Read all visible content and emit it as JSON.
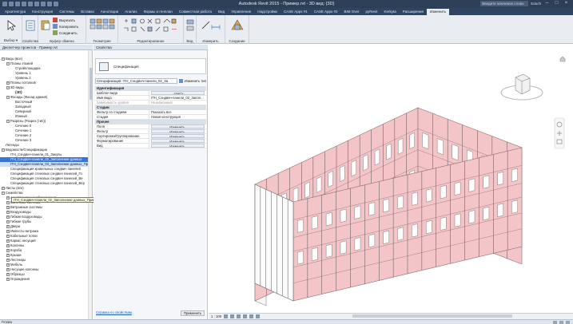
{
  "window": {
    "title": "Autodesk Revit 2015 -    Пример.rvt - 3D вид: {3D}",
    "search_placeholder": "Введите ключевое слово или фразу",
    "user": "Educh"
  },
  "ribbon": {
    "tabs": [
      "Архитектура",
      "Конструкция",
      "Системы",
      "Вставка",
      "Аннотации",
      "Анализ",
      "Формы и генплан",
      "Совместная работа",
      "Вид",
      "Управление",
      "Надстройки",
      "CASE Apps #1",
      "CASE Apps #2",
      "BIM Over",
      "pyRevit",
      "Kerkyta",
      "Расширения",
      "Изменить"
    ],
    "active_tab": "Изменить",
    "groups": {
      "select": "Выбор ▾",
      "properties": "Свойства",
      "clipboard": "Буфер обмена",
      "geometry": "Геометрия",
      "modify": "Редактирование",
      "view": "Вид",
      "measure": "Измерить",
      "create": "Создание"
    },
    "small_buttons": {
      "cut": "Вырезать",
      "copy": "Копировать",
      "join": "Соединить",
      "paste": "Вставить"
    }
  },
  "browser": {
    "title": "Диспетчер проектов - Пример.rvt",
    "tooltip": "ITH_Сэндвич-панели_02_Заполнение данных_Принудительная",
    "items": [
      {
        "indent": 0,
        "toggle": "−",
        "label": "Виды (все)"
      },
      {
        "indent": 1,
        "toggle": "−",
        "label": "Планы этажей"
      },
      {
        "indent": 2,
        "toggle": "",
        "label": "Стройплощадка"
      },
      {
        "indent": 2,
        "toggle": "",
        "label": "Уровень 1"
      },
      {
        "indent": 2,
        "toggle": "",
        "label": "Уровень 2"
      },
      {
        "indent": 1,
        "toggle": "+",
        "label": "Планы потолков"
      },
      {
        "indent": 1,
        "toggle": "−",
        "label": "3D виды"
      },
      {
        "indent": 2,
        "toggle": "",
        "label": "{3D}",
        "bold": true
      },
      {
        "indent": 1,
        "toggle": "−",
        "label": "Фасады (Фасад здания)"
      },
      {
        "indent": 2,
        "toggle": "",
        "label": "Восточный"
      },
      {
        "indent": 2,
        "toggle": "",
        "label": "Западный"
      },
      {
        "indent": 2,
        "toggle": "",
        "label": "Северный"
      },
      {
        "indent": 2,
        "toggle": "",
        "label": "Южный"
      },
      {
        "indent": 1,
        "toggle": "−",
        "label": "Разрезы (Разрез (тип))"
      },
      {
        "indent": 2,
        "toggle": "",
        "label": "Сечение 0"
      },
      {
        "indent": 2,
        "toggle": "",
        "label": "Сечение 1"
      },
      {
        "indent": 2,
        "toggle": "",
        "label": "Сечение 2"
      },
      {
        "indent": 2,
        "toggle": "",
        "label": "Сечение 3"
      },
      {
        "indent": 0,
        "toggle": "",
        "label": "Легенды"
      },
      {
        "indent": 0,
        "toggle": "−",
        "label": "Ведомости/Спецификации"
      },
      {
        "indent": 1,
        "toggle": "",
        "label": "ITH_Сэндвич-панели_01_Закупы"
      },
      {
        "indent": 1,
        "toggle": "",
        "label": "ITH_Сэндвич-панели_02_Заполнение данных",
        "state": "sel"
      },
      {
        "indent": 1,
        "toggle": "",
        "label": "ITH_Сэндвич-панели_03_Заполнение данных_Принудительная",
        "state": "hl"
      },
      {
        "indent": 1,
        "toggle": "",
        "label": "Спецификация кровельных сэндвич панелей"
      },
      {
        "indent": 1,
        "toggle": "",
        "label": "Спецификация стеновых сэндвич панелей_Го"
      },
      {
        "indent": 1,
        "toggle": "",
        "label": "Спецификация стеновых сэндвич панелей_Ве"
      },
      {
        "indent": 1,
        "toggle": "",
        "label": "Спецификация стеновых сэндвич панелей_Вер"
      },
      {
        "indent": 0,
        "toggle": "+",
        "label": "Листы (все)"
      },
      {
        "indent": 0,
        "toggle": "−",
        "label": "Семейства"
      },
      {
        "indent": 1,
        "toggle": "+",
        "label": "Аннотационные обозначения"
      },
      {
        "indent": 1,
        "toggle": "+",
        "label": "Балочные системы"
      },
      {
        "indent": 1,
        "toggle": "+",
        "label": "Витражные системы"
      },
      {
        "indent": 1,
        "toggle": "+",
        "label": "Воздуховоды"
      },
      {
        "indent": 1,
        "toggle": "+",
        "label": "Гибкие воздуховоды"
      },
      {
        "indent": 1,
        "toggle": "+",
        "label": "Гибкие трубы"
      },
      {
        "indent": 1,
        "toggle": "+",
        "label": "Двери"
      },
      {
        "indent": 1,
        "toggle": "+",
        "label": "Импосты витража"
      },
      {
        "indent": 1,
        "toggle": "+",
        "label": "Кабельные лотки"
      },
      {
        "indent": 1,
        "toggle": "+",
        "label": "Каркас несущий"
      },
      {
        "indent": 1,
        "toggle": "+",
        "label": "Колонны"
      },
      {
        "indent": 1,
        "toggle": "+",
        "label": "Короба"
      },
      {
        "indent": 1,
        "toggle": "+",
        "label": "Крыши"
      },
      {
        "indent": 1,
        "toggle": "+",
        "label": "Лестницы"
      },
      {
        "indent": 1,
        "toggle": "+",
        "label": "Мебель"
      },
      {
        "indent": 1,
        "toggle": "+",
        "label": "Несущие колонны"
      },
      {
        "indent": 1,
        "toggle": "+",
        "label": "Образцы"
      },
      {
        "indent": 1,
        "toggle": "+",
        "label": "Ограждения"
      }
    ]
  },
  "properties": {
    "title": "Свойства",
    "type_name": "Спецификация",
    "instance_label": "Спецификация: ITH_Сэндвич-панели_02_За",
    "edit_type": "Изменить тип",
    "categories": [
      {
        "name": "Идентификация",
        "rows": [
          {
            "n": "Шаблон вида",
            "v": "<Нет>",
            "kind": "btn"
          },
          {
            "n": "Имя вида",
            "v": "ITH_Сэндвич-панели_02_Запол..."
          },
          {
            "n": "Зависимость уровня",
            "v": "Независимый",
            "grey": true
          }
        ]
      },
      {
        "name": "Стадии",
        "rows": [
          {
            "n": "Фильтр по стадиям",
            "v": "Показать все"
          },
          {
            "n": "Стадия",
            "v": "Новая конструкция"
          }
        ]
      },
      {
        "name": "Прочее",
        "rows": [
          {
            "n": "Поля",
            "v": "Изменить...",
            "kind": "btn"
          },
          {
            "n": "Фильтр",
            "v": "Изменить...",
            "kind": "btn"
          },
          {
            "n": "Сортировка/Группирование",
            "v": "Изменить...",
            "kind": "btn"
          },
          {
            "n": "Форматирование",
            "v": "Изменить...",
            "kind": "btn"
          },
          {
            "n": "Вид",
            "v": "Изменить...",
            "kind": "btn"
          }
        ]
      }
    ],
    "help_link": "Справка по свойствам",
    "apply": "Применить"
  },
  "view": {
    "scale": "1 : 100",
    "status": "Готово",
    "statusbar_text": "Готово"
  },
  "colors": {
    "title_bg": "#2d3f57",
    "ribbon_bg": "#e9edf2",
    "selection": "#3875d7",
    "panel_fill": "#f3c4c8",
    "panel_stroke": "#8c6e72"
  }
}
